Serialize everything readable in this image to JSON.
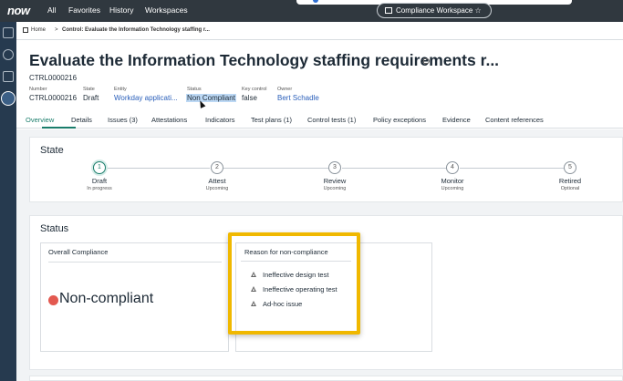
{
  "nav": {
    "logo": "now",
    "items": [
      "All",
      "Favorites",
      "History",
      "Workspaces"
    ],
    "workspace_pill": "Compliance Workspace ☆"
  },
  "breadcrumb": [
    "Home",
    ">",
    "Control: Evaluate the Information Technology staffing r..."
  ],
  "record": {
    "title": "Evaluate the Information Technology staffing requirements r...",
    "number_line": "CTRL0000216",
    "fields": [
      {
        "label": "Number",
        "value": "CTRL0000216"
      },
      {
        "label": "State",
        "value": "Draft"
      },
      {
        "label": "Entity",
        "value": "Workday applicati..."
      },
      {
        "label": "Status",
        "value": "Non Compliant"
      },
      {
        "label": "Key control",
        "value": "false"
      },
      {
        "label": "Owner",
        "value": "Bert Schadle"
      }
    ]
  },
  "tabs": [
    "Overview",
    "Details",
    "Issues (3)",
    "Attestations",
    "Indicators",
    "Test plans (1)",
    "Control tests (1)",
    "Policy exceptions",
    "Evidence",
    "Content references"
  ],
  "state_section": {
    "title": "State",
    "steps": [
      {
        "num": "1",
        "name": "Draft",
        "sub": "In progress"
      },
      {
        "num": "2",
        "name": "Attest",
        "sub": "Upcoming"
      },
      {
        "num": "3",
        "name": "Review",
        "sub": "Upcoming"
      },
      {
        "num": "4",
        "name": "Monitor",
        "sub": "Upcoming"
      },
      {
        "num": "5",
        "name": "Retired",
        "sub": "Optional"
      }
    ]
  },
  "status_section": {
    "title": "Status",
    "overall_label": "Overall Compliance",
    "overall_value": "Non-compliant",
    "reason_label": "Reason for non-compliance",
    "reasons": [
      "Ineffective design test",
      "Ineffective operating test",
      "Ad-hoc issue"
    ]
  },
  "colors": {
    "topnav": "#30383f",
    "rail": "#263a4f",
    "accent": "#1a7d6b",
    "link": "#2a5fba",
    "highlight_frame": "#f0b800",
    "noncompliant_dot": "#e35950"
  }
}
